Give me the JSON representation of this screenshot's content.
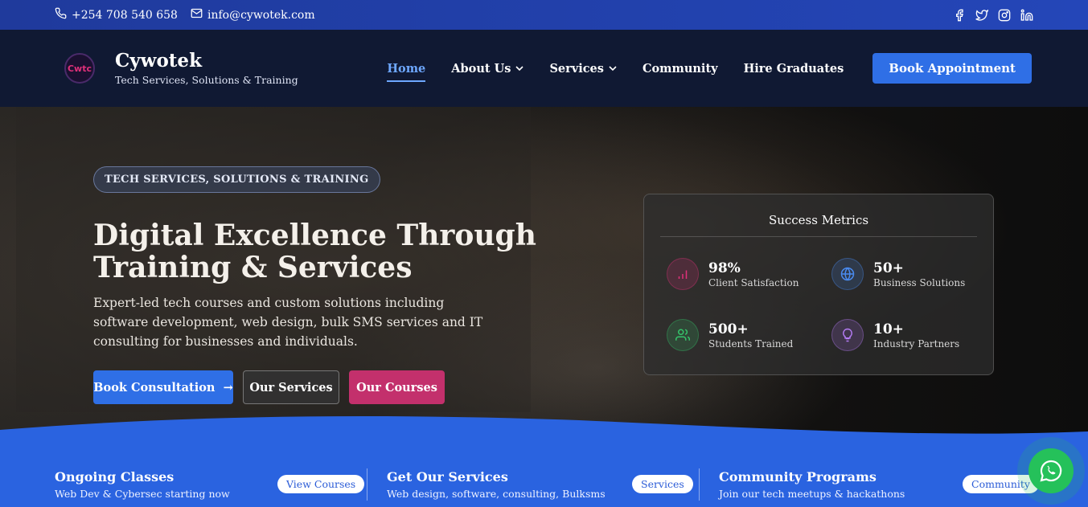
{
  "topbar": {
    "phone": "+254 708 540 658",
    "email": "info@cywotek.com",
    "socials": [
      "facebook-icon",
      "twitter-icon",
      "instagram-icon",
      "linkedin-icon"
    ]
  },
  "header": {
    "logo_text": "Cwtc",
    "brand_name": "Cywotek",
    "brand_tagline": "Tech Services, Solutions & Training",
    "nav": [
      {
        "label": "Home",
        "active": true
      },
      {
        "label": "About Us",
        "dropdown": true
      },
      {
        "label": "Services",
        "dropdown": true
      },
      {
        "label": "Community"
      },
      {
        "label": "Hire Graduates"
      }
    ],
    "cta": "Book Appointment"
  },
  "hero": {
    "pill": "TECH SERVICES, SOLUTIONS & TRAINING",
    "title_line1": "Digital Excellence Through",
    "title_line2": "Training & Services",
    "description": "Expert-led tech courses and custom solutions including software development, web design, bulk SMS services and IT consulting for businesses and individuals.",
    "buttons": {
      "consult": "Book Consultation",
      "consult_arrow": "→",
      "services": "Our Services",
      "courses": "Our Courses"
    }
  },
  "metrics": {
    "title": "Success Metrics",
    "items": [
      {
        "value": "98%",
        "label": "Client Satisfaction",
        "icon": "chart-icon",
        "color": "#e0307a"
      },
      {
        "value": "50+",
        "label": "Business Solutions",
        "icon": "globe-icon",
        "color": "#4a8bf0"
      },
      {
        "value": "500+",
        "label": "Students Trained",
        "icon": "users-icon",
        "color": "#35c36a"
      },
      {
        "value": "10+",
        "label": "Industry Partners",
        "icon": "lightbulb-icon",
        "color": "#b57cf5"
      }
    ]
  },
  "strip": [
    {
      "title": "Ongoing Classes",
      "sub": "Web Dev & Cybersec starting now",
      "button": "View Courses"
    },
    {
      "title": "Get Our Services",
      "sub": "Web design, software, consulting, Bulksms",
      "button": "Services"
    },
    {
      "title": "Community Programs",
      "sub": "Join our tech meetups & hackathons",
      "button": "Community"
    }
  ],
  "colors": {
    "primary": "#2f6fe6",
    "accent": "#c3306c",
    "topbar": "#2446b8",
    "whatsapp": "#25c15a"
  }
}
